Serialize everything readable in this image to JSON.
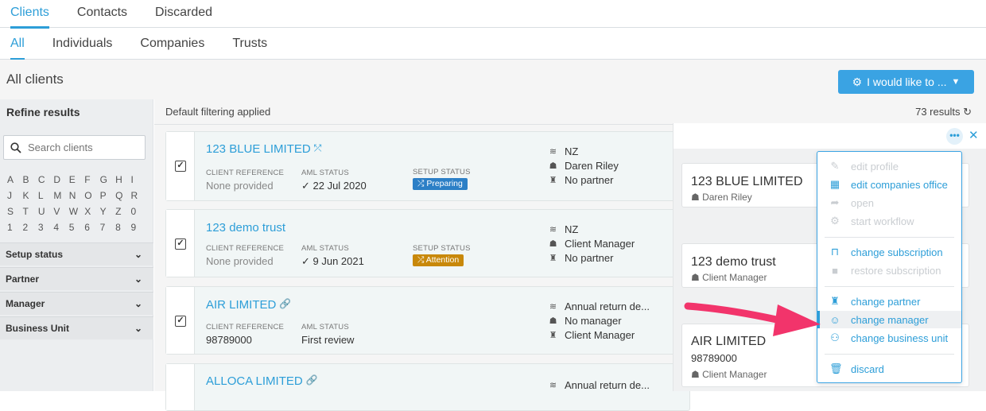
{
  "tabs_top": [
    "Clients",
    "Contacts",
    "Discarded"
  ],
  "tabs_sub": [
    "All",
    "Individuals",
    "Companies",
    "Trusts"
  ],
  "header": {
    "title": "All clients",
    "action_label": "I would like to ..."
  },
  "sidebar": {
    "refine_label": "Refine results",
    "search_placeholder": "Search clients",
    "alphabet": [
      "A",
      "B",
      "C",
      "D",
      "E",
      "F",
      "G",
      "H",
      "I",
      "J",
      "K",
      "L",
      "M",
      "N",
      "O",
      "P",
      "Q",
      "R",
      "S",
      "T",
      "U",
      "V",
      "W",
      "X",
      "Y",
      "Z",
      "0",
      "1",
      "2",
      "3",
      "4",
      "5",
      "6",
      "7",
      "8",
      "9"
    ],
    "facets": [
      "Setup status",
      "Partner",
      "Manager",
      "Business Unit"
    ]
  },
  "filterbar": {
    "note": "Default filtering applied",
    "results": "73 results"
  },
  "clients": [
    {
      "name": "123 BLUE LIMITED",
      "ref_label": "CLIENT REFERENCE",
      "ref": "None provided",
      "aml_label": "AML STATUS",
      "aml": "✓ 22 Jul 2020",
      "setup_label": "SETUP STATUS",
      "setup": "Preparing",
      "m1": "NZ",
      "m2": "Daren Riley",
      "m3": "No partner"
    },
    {
      "name": "123 demo trust",
      "ref_label": "CLIENT REFERENCE",
      "ref": "None provided",
      "aml_label": "AML STATUS",
      "aml": "✓ 9 Jun 2021",
      "setup_label": "SETUP STATUS",
      "setup": "Attention",
      "m1": "NZ",
      "m2": "Client Manager",
      "m3": "No partner"
    },
    {
      "name": "AIR LIMITED",
      "ref_label": "CLIENT REFERENCE",
      "ref": "98789000",
      "aml_label": "AML STATUS",
      "aml": "First review",
      "m1": "Annual return de...",
      "m2": "No manager",
      "m3": "Client Manager"
    },
    {
      "name": "ALLOCA LIMITED",
      "m1": "Annual return de..."
    }
  ],
  "panel_cards": [
    {
      "name": "123 BLUE LIMITED",
      "sub": "Daren Riley"
    },
    {
      "name": "123 demo trust",
      "sub": "Client Manager"
    },
    {
      "name": "AIR LIMITED",
      "ref": "98789000",
      "sub": "Client Manager"
    }
  ],
  "menu": {
    "edit_profile": "edit profile",
    "edit_companies_office": "edit companies office",
    "open": "open",
    "start_workflow": "start workflow",
    "change_subscription": "change subscription",
    "restore_subscription": "restore subscription",
    "change_partner": "change partner",
    "change_manager": "change manager",
    "change_business_unit": "change business unit",
    "discard": "discard"
  },
  "colors": {
    "accent": "#2d9ed8",
    "preparing": "#2c7fc6",
    "attention": "#c8880a",
    "arrow": "#f2346b"
  }
}
